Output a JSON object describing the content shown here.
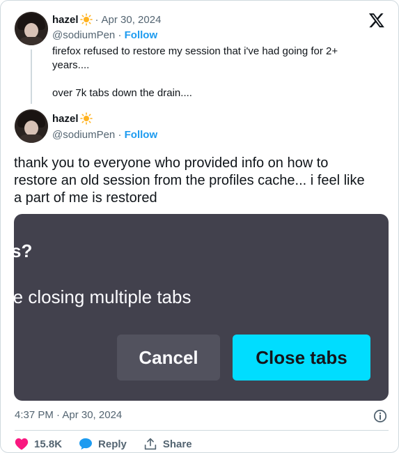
{
  "first_post": {
    "name": "hazel",
    "date": "Apr 30, 2024",
    "handle": "@sodiumPen",
    "follow_label": "Follow",
    "text": "firefox refused to restore my session that i've had going for 2+\nyears....\n\nover 7k tabs down the drain...."
  },
  "second_post": {
    "name": "hazel",
    "handle": "@sodiumPen",
    "follow_label": "Follow",
    "text_lines": [
      "thank you to everyone who provided info on how to",
      "restore an old session from the profiles cache... i feel like",
      "a part of me is restored"
    ]
  },
  "media": {
    "question": "s?",
    "description": "re closing multiple tabs",
    "cancel_label": "Cancel",
    "close_label": "Close tabs"
  },
  "footer": {
    "timestamp": "4:37 PM · Apr 30, 2024",
    "likes": "15.8K",
    "reply_label": "Reply",
    "share_label": "Share"
  },
  "icons": {
    "platform": "x-logo-icon",
    "emoji": "sun-icon",
    "info": "info-icon",
    "like": "heart-icon",
    "reply": "reply-bubble-icon",
    "share": "share-icon"
  },
  "colors": {
    "link": "#1d9bf0",
    "muted": "#536471",
    "like": "#f91880",
    "dialog_bg": "#42414d",
    "primary_button": "#00ddff"
  }
}
